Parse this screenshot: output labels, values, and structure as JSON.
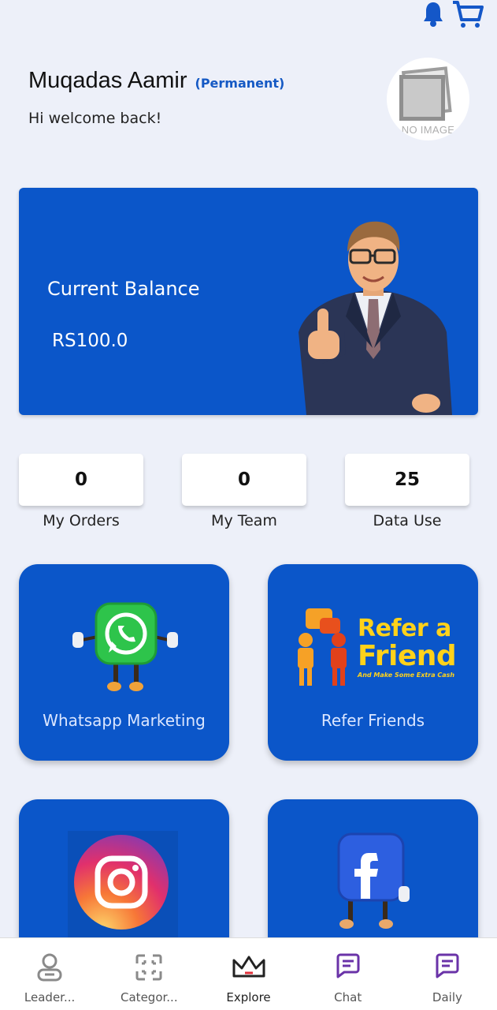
{
  "header": {
    "user_name": "Muqadas Aamir",
    "user_type": "(Permanent)",
    "welcome": "Hi welcome back!",
    "avatar_placeholder": "NO IMAGE"
  },
  "top_icons": [
    "bell-icon",
    "cart-icon"
  ],
  "balance": {
    "label": "Current Balance",
    "value": "RS100.0"
  },
  "stats": [
    {
      "value": "0",
      "label": "My Orders"
    },
    {
      "value": "0",
      "label": "My Team"
    },
    {
      "value": "25",
      "label": "Data Use"
    }
  ],
  "tiles": [
    {
      "label": "Whatsapp Marketing",
      "icon": "whatsapp-icon"
    },
    {
      "label": "Refer Friends",
      "icon": "refer-friend-icon",
      "art_title_line1": "Refer a",
      "art_title_line2": "Friend",
      "art_subtitle": "And Make Some Extra Cash"
    },
    {
      "label": "",
      "icon": "instagram-icon"
    },
    {
      "label": "",
      "icon": "facebook-icon"
    }
  ],
  "nav": [
    {
      "label": "Leader...",
      "icon": "user-icon"
    },
    {
      "label": "Categor...",
      "icon": "categories-icon"
    },
    {
      "label": "Explore",
      "icon": "crown-icon"
    },
    {
      "label": "Chat",
      "icon": "chat-icon"
    },
    {
      "label": "Daily",
      "icon": "chat-icon"
    }
  ],
  "colors": {
    "background": "#edf0f9",
    "primary": "#0b56c9",
    "accent_text": "#1559c4",
    "nav_icon": "#6a33a8"
  }
}
